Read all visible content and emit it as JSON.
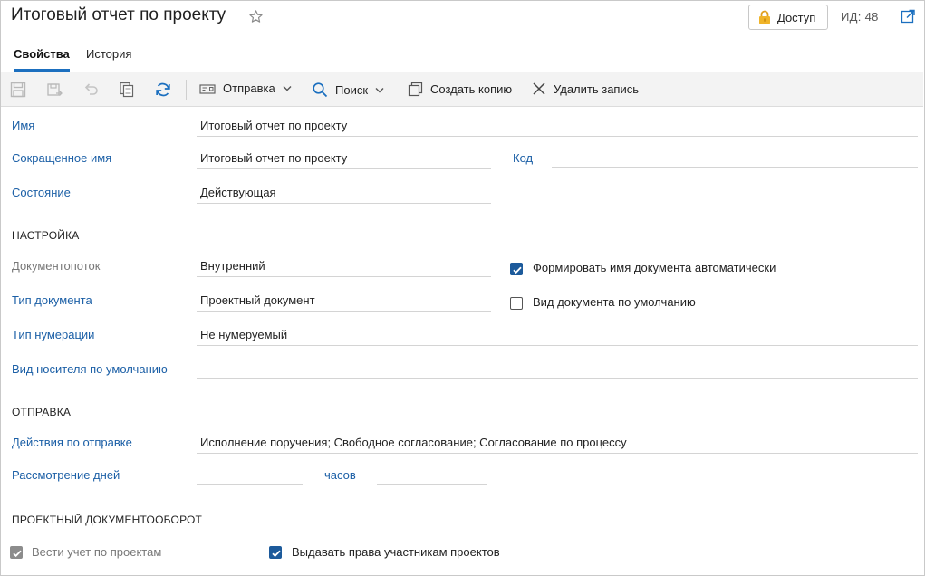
{
  "header": {
    "title": "Итоговый отчет по проекту",
    "access_label": "Доступ",
    "id_label": "ИД: 48"
  },
  "tabs": [
    {
      "label": "Свойства",
      "active": true
    },
    {
      "label": "История",
      "active": false
    }
  ],
  "toolbar": {
    "send_label": "Отправка",
    "search_label": "Поиск",
    "copy_label": "Создать копию",
    "delete_label": "Удалить запись"
  },
  "form": {
    "name_label": "Имя",
    "name_value": "Итоговый отчет по проекту",
    "short_name_label": "Сокращенное имя",
    "short_name_value": "Итоговый отчет по проекту",
    "code_label": "Код",
    "code_value": "",
    "state_label": "Состояние",
    "state_value": "Действующая"
  },
  "settings": {
    "heading": "НАСТРОЙКА",
    "flow_label": "Документопоток",
    "flow_value": "Внутренний",
    "auto_name_label": "Формировать имя документа автоматически",
    "auto_name_checked": true,
    "doc_type_label": "Тип документа",
    "doc_type_value": "Проектный документ",
    "default_kind_label": "Вид документа по умолчанию",
    "default_kind_checked": false,
    "numbering_label": "Тип нумерации",
    "numbering_value": "Не нумеруемый",
    "medium_label": "Вид носителя по умолчанию",
    "medium_value": ""
  },
  "sending": {
    "heading": "ОТПРАВКА",
    "actions_label": "Действия по отправке",
    "actions_value": "Исполнение поручения; Свободное согласование; Согласование по процессу",
    "review_days_label": "Рассмотрение дней",
    "review_days_value": "",
    "hours_label": "часов",
    "hours_value": ""
  },
  "project_flow": {
    "heading": "ПРОЕКТНЫЙ ДОКУМЕНТООБОРОТ",
    "track_label": "Вести учет по проектам",
    "track_checked": true,
    "grant_label": "Выдавать права участникам проектов",
    "grant_checked": true
  },
  "colors": {
    "accent": "#1b6fbf",
    "label_blue": "#1b5fa6",
    "checkbox_blue": "#1c5a9b",
    "toolbar_bg": "#f3f3f3"
  }
}
